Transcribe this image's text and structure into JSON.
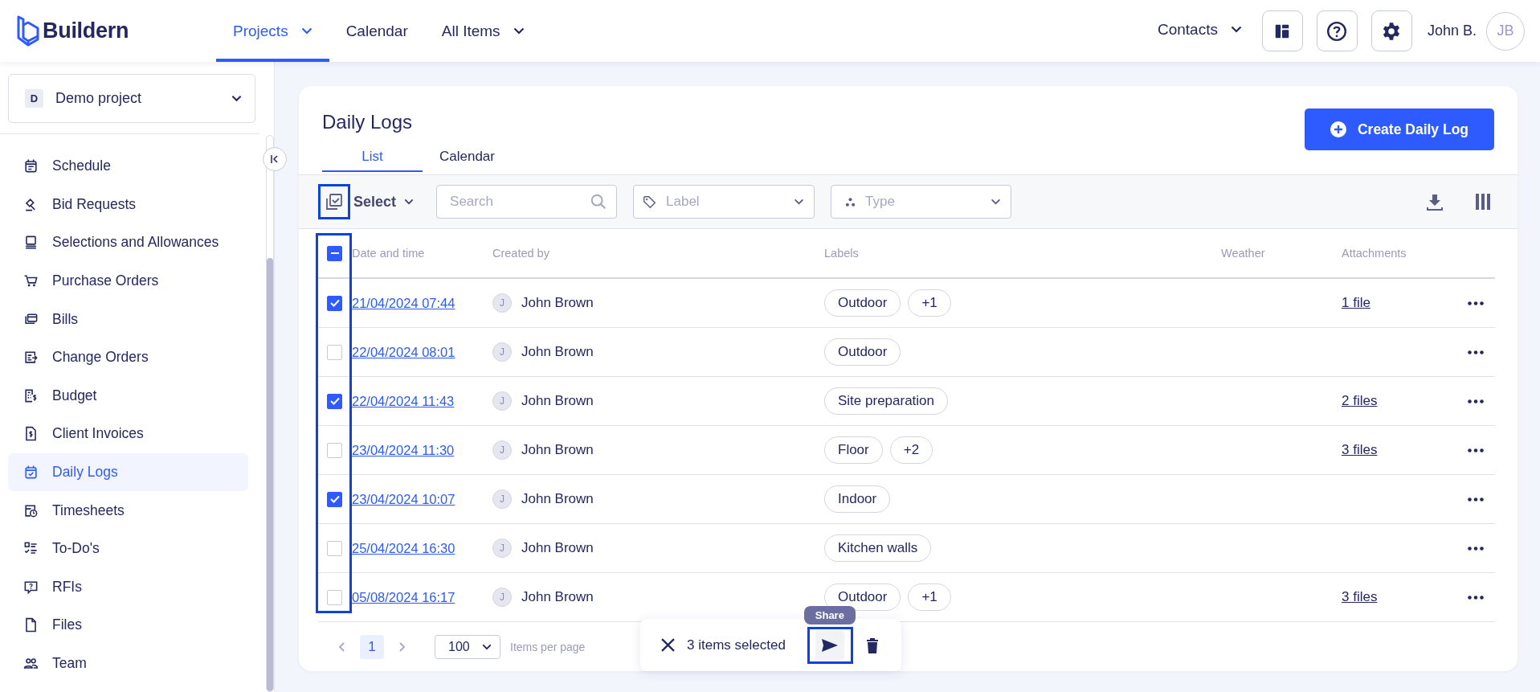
{
  "header": {
    "logo": "Buildern",
    "nav": [
      {
        "label": "Projects",
        "selected": true,
        "dropdown": true
      },
      {
        "label": "Calendar",
        "selected": false,
        "dropdown": false
      },
      {
        "label": "All Items",
        "selected": false,
        "dropdown": true
      }
    ],
    "contacts": "Contacts",
    "user_name": "John B.",
    "avatar": "JB"
  },
  "sidebar": {
    "project": {
      "badge": "D",
      "name": "Demo project"
    },
    "items": [
      {
        "label": "Schedule",
        "selected": false
      },
      {
        "label": "Bid Requests",
        "selected": false
      },
      {
        "label": "Selections and Allowances",
        "selected": false
      },
      {
        "label": "Purchase Orders",
        "selected": false
      },
      {
        "label": "Bills",
        "selected": false
      },
      {
        "label": "Change Orders",
        "selected": false
      },
      {
        "label": "Budget",
        "selected": false
      },
      {
        "label": "Client Invoices",
        "selected": false
      },
      {
        "label": "Daily Logs",
        "selected": true
      },
      {
        "label": "Timesheets",
        "selected": false
      },
      {
        "label": "To-Do's",
        "selected": false
      },
      {
        "label": "RFIs",
        "selected": false
      },
      {
        "label": "Files",
        "selected": false
      },
      {
        "label": "Team",
        "selected": false
      }
    ]
  },
  "page": {
    "title": "Daily Logs",
    "create_button": "Create Daily Log",
    "tabs": [
      {
        "label": "List",
        "selected": true
      },
      {
        "label": "Calendar",
        "selected": false
      }
    ],
    "toolbar": {
      "select": "Select",
      "search_placeholder": "Search",
      "label_placeholder": "Label",
      "type_placeholder": "Type"
    }
  },
  "table": {
    "indeterminate": true,
    "columns": [
      "Date and time",
      "Created by",
      "Labels",
      "Weather",
      "Attachments"
    ],
    "rows": [
      {
        "checked": true,
        "date": "21/04/2024 07:44",
        "initial": "J",
        "author": "John Brown",
        "labels": [
          "Outdoor",
          "+1"
        ],
        "attachments": "1 file"
      },
      {
        "checked": false,
        "date": "22/04/2024 08:01",
        "initial": "J",
        "author": "John Brown",
        "labels": [
          "Outdoor"
        ]
      },
      {
        "checked": true,
        "date": "22/04/2024 11:43",
        "initial": "J",
        "author": "John Brown",
        "labels": [
          "Site preparation"
        ],
        "attachments": "2 files"
      },
      {
        "checked": false,
        "date": "23/04/2024 11:30",
        "initial": "J",
        "author": "John Brown",
        "labels": [
          "Floor",
          "+2"
        ],
        "attachments": "3 files"
      },
      {
        "checked": true,
        "date": "23/04/2024 10:07",
        "initial": "J",
        "author": "John Brown",
        "labels": [
          "Indoor"
        ]
      },
      {
        "checked": false,
        "date": "25/04/2024 16:30",
        "initial": "J",
        "author": "John Brown",
        "labels": [
          "Kitchen walls"
        ]
      },
      {
        "checked": false,
        "date": "05/08/2024 16:17",
        "initial": "J",
        "author": "John Brown",
        "labels": [
          "Outdoor",
          "+1"
        ],
        "attachments": "3 files"
      }
    ]
  },
  "pagination": {
    "page": "1",
    "per_page": "100",
    "per_page_label": "Items per page"
  },
  "selection_bar": {
    "count": "3 items selected",
    "tooltip": "Share"
  }
}
